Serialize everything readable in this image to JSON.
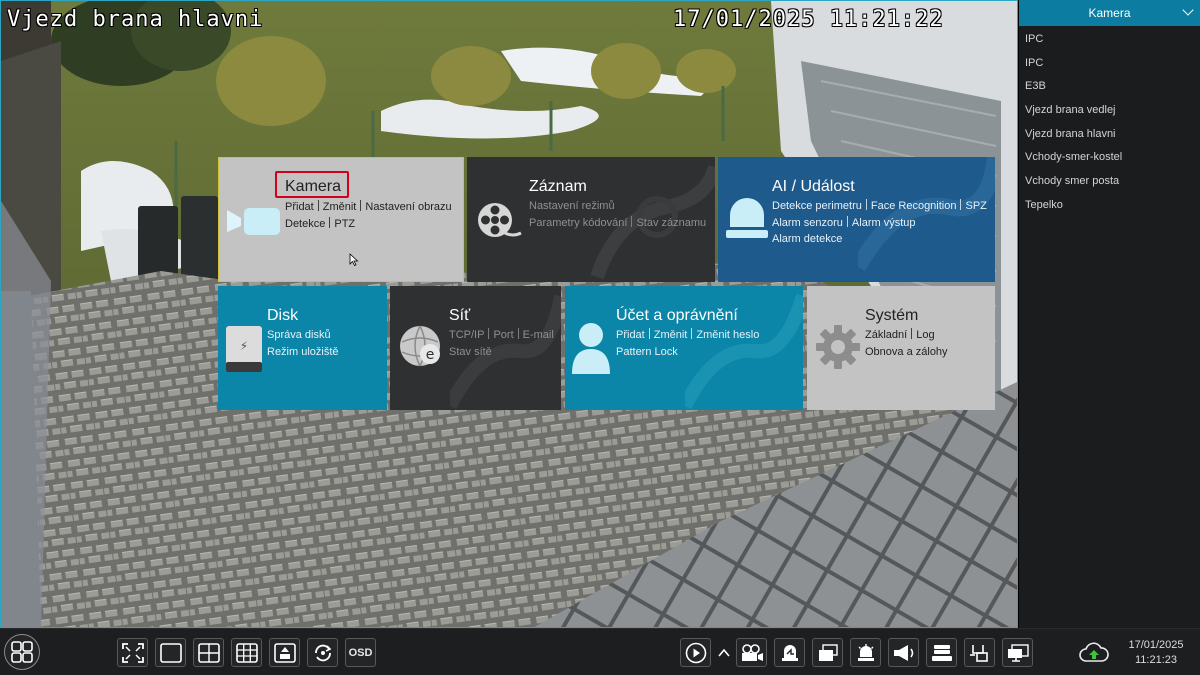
{
  "osd": {
    "camera_name": "Vjezd brana hlavni",
    "datetime": "17/01/2025 11:21:22"
  },
  "channel_panel": {
    "header": "Kamera",
    "channels": [
      "IPC",
      "IPC",
      "E3B",
      "Vjezd brana vedlej",
      "Vjezd brana hlavni",
      "Vchody-smer-kostel",
      "Vchody smer posta",
      "Tepelko"
    ]
  },
  "menu": {
    "camera": {
      "title": "Kamera",
      "line1": [
        "Přidat",
        "Změnit",
        "Nastavení obrazu"
      ],
      "line2": [
        "Detekce",
        "PTZ"
      ]
    },
    "record": {
      "title": "Záznam",
      "line1": [
        "Nastavení režimů"
      ],
      "line2": [
        "Parametry kódování",
        "Stav záznamu"
      ]
    },
    "ai": {
      "title": "AI / Událost",
      "line1": [
        "Detekce perimetru",
        "Face Recognition",
        "SPZ"
      ],
      "line2": [
        "Alarm senzoru",
        "Alarm výstup"
      ],
      "line3": [
        "Alarm detekce"
      ]
    },
    "disk": {
      "title": "Disk",
      "line1": [
        "Správa disků"
      ],
      "line2": [
        "Režim uložiště"
      ]
    },
    "network": {
      "title": "Síť",
      "line1": [
        "TCP/IP",
        "Port",
        "E-mail"
      ],
      "line2": [
        "Stav sítě"
      ]
    },
    "account": {
      "title": "Účet a oprávnění",
      "line1": [
        "Přidat",
        "Změnit",
        "Změnit heslo"
      ],
      "line2": [
        "Pattern Lock"
      ]
    },
    "system": {
      "title": "Systém",
      "line1": [
        "Základní",
        "Log"
      ],
      "line2": [
        "Obnova a zálohy"
      ]
    }
  },
  "toolbar": {
    "osd_label": "OSD",
    "date": "17/01/2025",
    "time": "11:21:23"
  },
  "colors": {
    "accent_blue": "#0c7ca0",
    "ai_tile": "#1e5a8e",
    "highlight_red": "#d0021b"
  }
}
